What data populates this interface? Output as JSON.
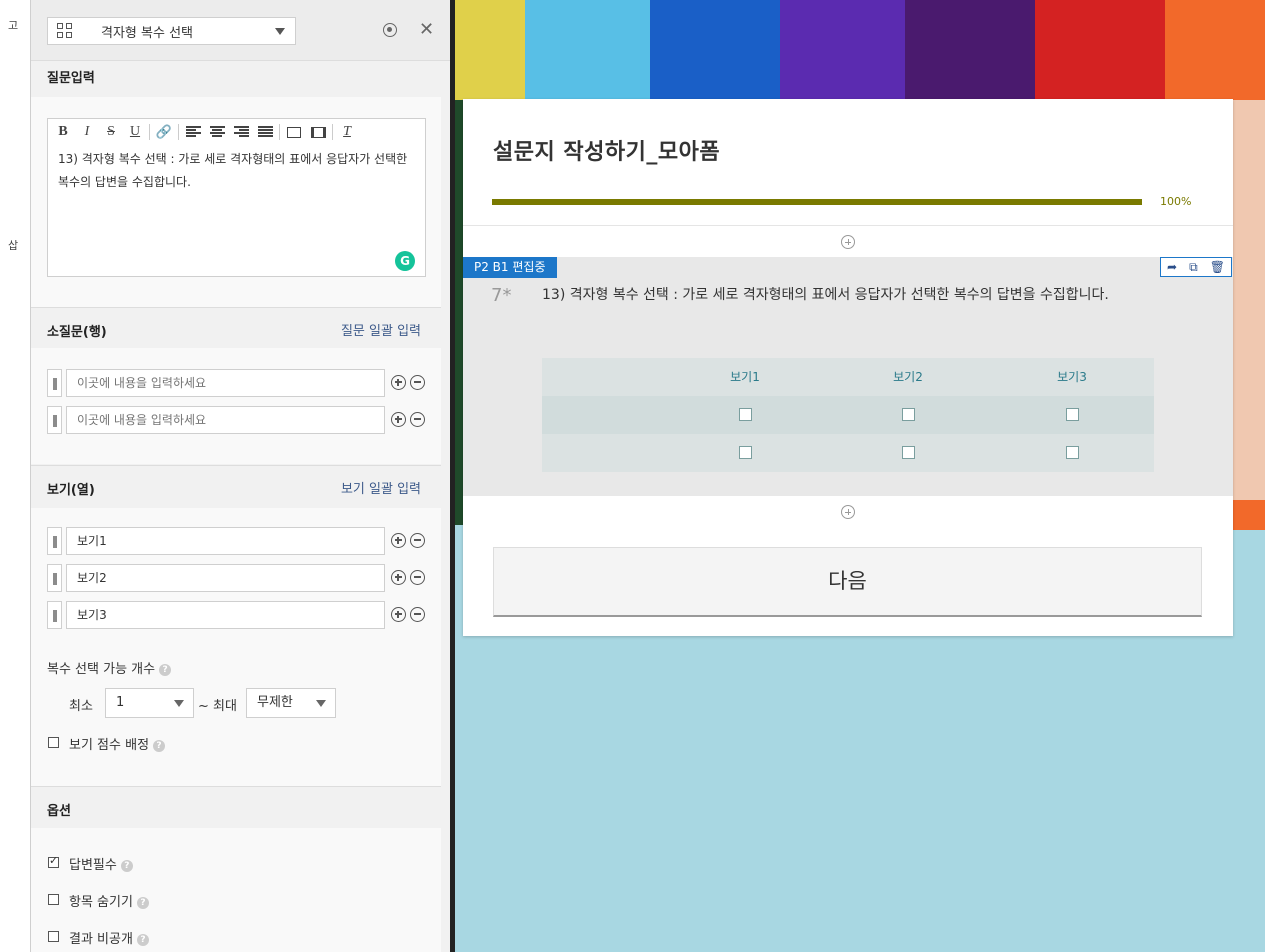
{
  "strip": {
    "label_top": "고",
    "label_mid": "삽"
  },
  "panel": {
    "type_select_label": "격자형 복수 선택",
    "question_section_title": "질문입력",
    "question_text": "13) 격자형 복수 선택 : 가로 세로 격자형태의 표에서 응답자가 선택한 복수의 답변을 수집합니다.",
    "rows_section_title": "소질문(행)",
    "rows_bulk_link": "질문 일괄 입력",
    "rows": [
      {
        "value": "",
        "placeholder": "이곳에 내용을 입력하세요"
      },
      {
        "value": "",
        "placeholder": "이곳에 내용을 입력하세요"
      }
    ],
    "cols_section_title": "보기(열)",
    "cols_bulk_link": "보기 일괄 입력",
    "cols": [
      {
        "value": "보기1"
      },
      {
        "value": "보기2"
      },
      {
        "value": "보기3"
      }
    ],
    "multi_count_label": "복수 선택 가능 개수",
    "min_label": "최소",
    "min_value": "1",
    "max_label": "~ 최대",
    "max_value": "무제한",
    "score_label": "보기 점수 배정",
    "options_section_title": "옵션",
    "options": [
      {
        "label": "답변필수",
        "checked": true
      },
      {
        "label": "항목 숨기기",
        "checked": false
      },
      {
        "label": "결과 비공개",
        "checked": false
      }
    ]
  },
  "survey": {
    "title": "설문지 작성하기_모아폼",
    "progress_percent": 100,
    "progress_label": "100%",
    "edit_badge": "P2 B1 편집중",
    "question_number": "7*",
    "question_text": "13) 격자형 복수 선택 : 가로 세로 격자형태의 표에서 응답자가 선택한 복수의 답변을 수집합니다.",
    "matrix_columns": [
      "보기1",
      "보기2",
      "보기3"
    ],
    "matrix_row_count": 2,
    "next_button": "다음"
  },
  "colors": {
    "accent_blue": "#1d77c9",
    "progress": "#7a7a00",
    "grammarly": "#15c39a"
  }
}
